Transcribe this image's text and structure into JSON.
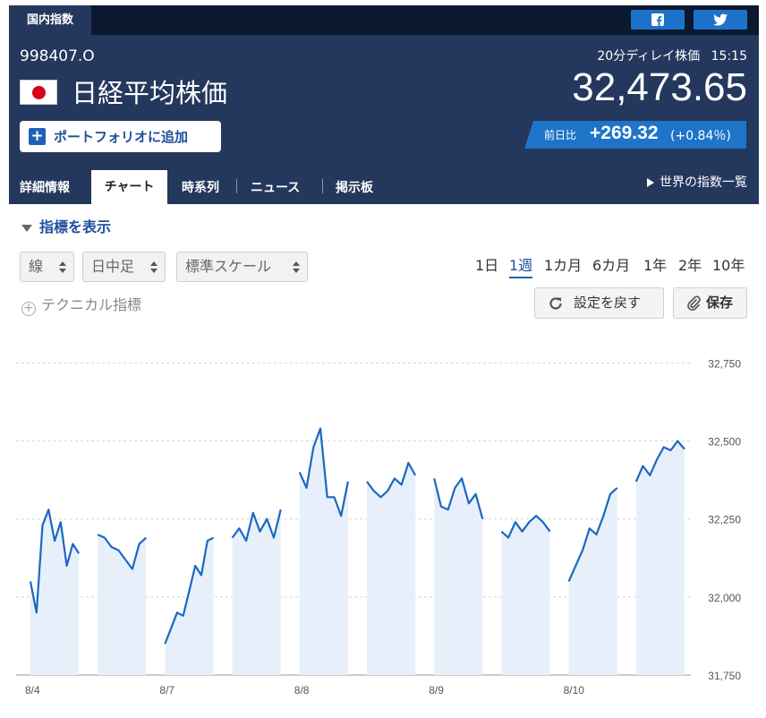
{
  "top_bar": {
    "tab_label": "国内指数",
    "share_buttons": [
      {
        "name": "facebook",
        "icon": "facebook-icon"
      },
      {
        "name": "twitter",
        "icon": "twitter-icon"
      }
    ]
  },
  "header": {
    "code": "998407.O",
    "flag_icon": "japan-flag-icon",
    "name": "日経平均株価",
    "portfolio_button_label": "ポートフォリオに追加",
    "delay_info": "20分ディレイ株価",
    "time": "15:15",
    "price": "32,473.65",
    "change_label": "前日比",
    "change_value": "+269.32",
    "change_pct": "(+0.84％)",
    "colors": {
      "dark_bg": "#24375d",
      "accent": "#1e74c8"
    }
  },
  "nav": {
    "tabs": [
      {
        "label": "詳細情報"
      },
      {
        "label": "チャート",
        "active": true
      },
      {
        "label": "時系列"
      },
      {
        "label": "ニュース"
      },
      {
        "label": "掲示板"
      }
    ],
    "world_indices_label": "世界の指数一覧"
  },
  "controls": {
    "indicator_toggle_label": "指標を表示",
    "selects": [
      {
        "value": "線"
      },
      {
        "value": "日中足"
      },
      {
        "value": "標準スケール"
      }
    ],
    "periods": [
      "1日",
      "1週",
      "1カ月",
      "6カ月",
      "1年",
      "2年",
      "10年"
    ],
    "active_period": "1週",
    "technical_label": "テクニカル指標",
    "reset_label": "設定を戻す",
    "save_label": "保存"
  },
  "chart_data": {
    "type": "line",
    "ylim": [
      31750,
      32800
    ],
    "y_ticks": [
      31750,
      32000,
      32250,
      32500,
      32750
    ],
    "y_tick_labels": [
      "31,750",
      "32,000",
      "32,250",
      "32,500",
      "32,750"
    ],
    "grid": true,
    "sessions": [
      {
        "label": "8/4",
        "values": [
          32050,
          31950,
          32230,
          32280,
          32180,
          32240,
          32100,
          32170,
          32140
        ]
      },
      {
        "label": "",
        "values": [
          32200,
          32190,
          32160,
          32150,
          32120,
          32090,
          32170,
          32190
        ]
      },
      {
        "label": "8/7",
        "values": [
          31850,
          31900,
          31950,
          31940,
          32020,
          32100,
          32070,
          32180,
          32190
        ]
      },
      {
        "label": "",
        "values": [
          32190,
          32220,
          32180,
          32270,
          32210,
          32250,
          32190,
          32280
        ]
      },
      {
        "label": "8/8",
        "values": [
          32400,
          32350,
          32480,
          32540,
          32320,
          32320,
          32260,
          32370
        ]
      },
      {
        "label": "",
        "values": [
          32370,
          32340,
          32320,
          32340,
          32380,
          32360,
          32430,
          32390
        ]
      },
      {
        "label": "8/9",
        "values": [
          32380,
          32290,
          32280,
          32350,
          32380,
          32300,
          32330,
          32250
        ]
      },
      {
        "label": "",
        "values": [
          32210,
          32190,
          32240,
          32210,
          32240,
          32260,
          32240,
          32210
        ]
      },
      {
        "label": "8/10",
        "values": [
          32050,
          32100,
          32150,
          32220,
          32200,
          32260,
          32330,
          32350
        ]
      },
      {
        "label": "",
        "values": [
          32370,
          32420,
          32390,
          32440,
          32480,
          32470,
          32500,
          32474
        ]
      }
    ],
    "colors": {
      "line": "#1a68c2",
      "fill": "#e7f0fa"
    }
  }
}
